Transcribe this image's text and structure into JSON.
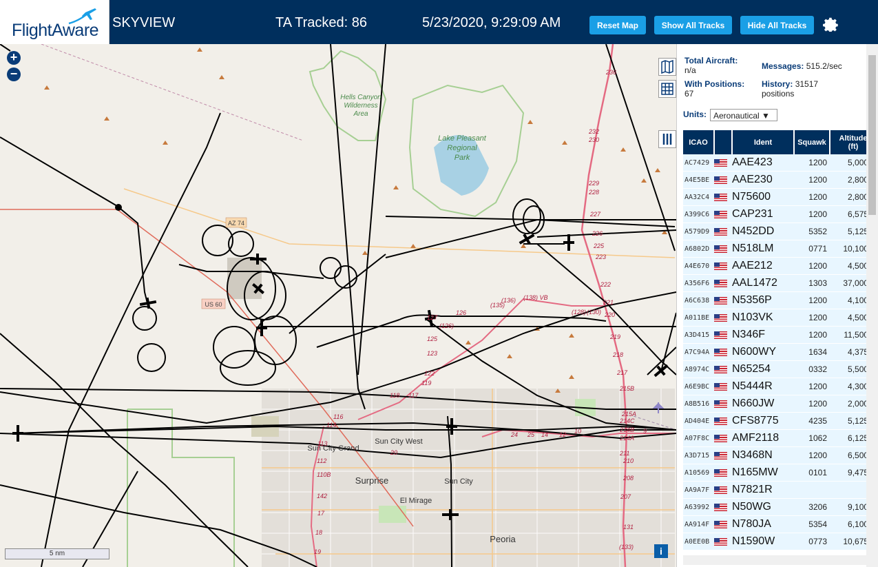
{
  "header": {
    "brand": "FlightAware",
    "app_name": "SKYVIEW",
    "ta_tracked": "TA Tracked: 86",
    "clock": "5/23/2020, 9:29:09 AM",
    "buttons": {
      "reset_map": "Reset Map",
      "show_all_tracks": "Show All Tracks",
      "hide_all_tracks": "Hide All Tracks"
    },
    "settings_icon": "gear-icon"
  },
  "map": {
    "zoom_in": "+",
    "zoom_out": "−",
    "scale": "5 nm",
    "info": "i",
    "places": {
      "hells_canyon": [
        "Hells Canyon",
        "Wilderness",
        "Area"
      ],
      "lake_pleasant": [
        "Lake Pleasant",
        "Regional",
        "Park"
      ],
      "sun_city_west": "Sun City West",
      "sun_city_grand": "Sun City Grand",
      "surprise": "Surprise",
      "sun_city": "Sun City",
      "el_mirage": "El Mirage",
      "peoria": "Peoria"
    },
    "shields": {
      "az74": "AZ 74",
      "us60": "US 60"
    },
    "exits": [
      "236",
      "232",
      "230",
      "229",
      "228",
      "227",
      "226",
      "225",
      "223",
      "222",
      "221",
      "220",
      "219",
      "218",
      "217",
      "215B",
      "215A",
      "214C",
      "214B",
      "214A",
      "211",
      "210",
      "208",
      "207",
      "131",
      "(133)",
      "(135)",
      "(136)",
      "(138) VB",
      "(128)",
      "(130)",
      "127",
      "126",
      "(126)",
      "125",
      "123",
      "122",
      "119",
      "118",
      "117",
      "116",
      "114",
      "113",
      "112",
      "110B",
      "142",
      "17",
      "18",
      "19",
      "20",
      "24",
      "25",
      "14",
      "12",
      "10",
      "9"
    ]
  },
  "stats": {
    "total_aircraft_label": "Total Aircraft:",
    "total_aircraft_value": "n/a",
    "with_positions_label": "With Positions:",
    "with_positions_value": "67",
    "messages_label": "Messages:",
    "messages_value": "515.2/sec",
    "history_label": "History:",
    "history_value": "31517",
    "history_unit": "positions"
  },
  "units": {
    "label": "Units:",
    "selected": "Aeronautical ▼"
  },
  "table": {
    "headers": {
      "icao": "ICAO",
      "ident": "Ident",
      "squawk": "Squawk",
      "altitude": "Altitude",
      "altitude_unit": "(ft)"
    },
    "rows": [
      {
        "icao": "AC7429",
        "ident": "AAE423",
        "squawk": "1200",
        "altitude": "5,000",
        "trend": ""
      },
      {
        "icao": "A4E5BE",
        "ident": "AAE230",
        "squawk": "1200",
        "altitude": "2,800",
        "trend": "▼"
      },
      {
        "icao": "AA32C4",
        "ident": "N75600",
        "squawk": "1200",
        "altitude": "2,800",
        "trend": "▲"
      },
      {
        "icao": "A399C6",
        "ident": "CAP231",
        "squawk": "1200",
        "altitude": "6,575",
        "trend": ""
      },
      {
        "icao": "A579D9",
        "ident": "N452DD",
        "squawk": "5352",
        "altitude": "5,125",
        "trend": ""
      },
      {
        "icao": "A6802D",
        "ident": "N518LM",
        "squawk": "0771",
        "altitude": "10,100",
        "trend": ""
      },
      {
        "icao": "A4E670",
        "ident": "AAE212",
        "squawk": "1200",
        "altitude": "4,500",
        "trend": ""
      },
      {
        "icao": "A356F6",
        "ident": "AAL1472",
        "squawk": "1303",
        "altitude": "37,000",
        "trend": ""
      },
      {
        "icao": "A6C638",
        "ident": "N5356P",
        "squawk": "1200",
        "altitude": "4,100",
        "trend": "▼"
      },
      {
        "icao": "A011BE",
        "ident": "N103VK",
        "squawk": "1200",
        "altitude": "4,500",
        "trend": "▼"
      },
      {
        "icao": "A3D415",
        "ident": "N346F",
        "squawk": "1200",
        "altitude": "11,500",
        "trend": "▲"
      },
      {
        "icao": "A7C94A",
        "ident": "N600WY",
        "squawk": "1634",
        "altitude": "4,375",
        "trend": "▲"
      },
      {
        "icao": "A8974C",
        "ident": "N65254",
        "squawk": "0332",
        "altitude": "5,500",
        "trend": "▲"
      },
      {
        "icao": "A6E9BC",
        "ident": "N5444R",
        "squawk": "1200",
        "altitude": "4,300",
        "trend": ""
      },
      {
        "icao": "A8B516",
        "ident": "N660JW",
        "squawk": "1200",
        "altitude": "2,000",
        "trend": "▼"
      },
      {
        "icao": "AD404E",
        "ident": "CFS8775",
        "squawk": "4235",
        "altitude": "5,125",
        "trend": ""
      },
      {
        "icao": "A07F8C",
        "ident": "AMF2118",
        "squawk": "1062",
        "altitude": "6,125",
        "trend": "▲"
      },
      {
        "icao": "A3D715",
        "ident": "N3468N",
        "squawk": "1200",
        "altitude": "6,500",
        "trend": "▲"
      },
      {
        "icao": "A10569",
        "ident": "N165MW",
        "squawk": "0101",
        "altitude": "9,475",
        "trend": ""
      },
      {
        "icao": "AA9A7F",
        "ident": "N7821R",
        "squawk": "",
        "altitude": "",
        "trend": ""
      },
      {
        "icao": "A63992",
        "ident": "N50WG",
        "squawk": "3206",
        "altitude": "9,100",
        "trend": ""
      },
      {
        "icao": "AA914F",
        "ident": "N780JA",
        "squawk": "5354",
        "altitude": "6,100",
        "trend": ""
      },
      {
        "icao": "A0EE0B",
        "ident": "N1590W",
        "squawk": "0773",
        "altitude": "10,675",
        "trend": ""
      }
    ]
  },
  "colors": {
    "header_bg": "#002f5d",
    "button_blue": "#1a9fe6",
    "row_bg": "#e8f6ff",
    "track": "#000000",
    "freeway": "#e46a82",
    "park_border": "#8fc27a"
  }
}
